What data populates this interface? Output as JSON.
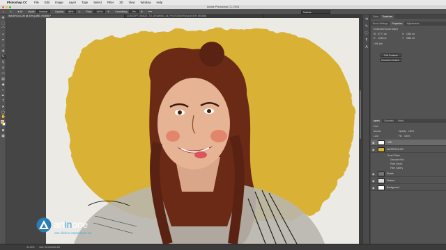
{
  "menubar": {
    "app": "Photoshop CC",
    "items": [
      "File",
      "Edit",
      "Image",
      "Layer",
      "Type",
      "Select",
      "Filter",
      "3D",
      "View",
      "Window",
      "Help"
    ]
  },
  "window": {
    "title": "Adobe Photoshop CC 2018"
  },
  "options": {
    "mode_label": "Mode:",
    "mode_value": "Normal",
    "opacity_label": "Opacity:",
    "opacity_value": "88%",
    "flow_label": "Flow:",
    "flow_value": "100%",
    "smoothing_label": "Smoothing:",
    "smoothing_value": "0%",
    "workspace": "Ilustrate"
  },
  "tabs": [
    {
      "label": "WATERCOLOR @ 33% (LINE, RGB/8) *"
    },
    {
      "label": "CONCEPT_IMAGE_TO_DRAWING_IN_PHOTOSHOP.psd @ 50% (RGB/8)"
    }
  ],
  "properties_panel": {
    "tabs": [
      "Color",
      "Swatches"
    ],
    "sub_tabs": [
      "Brush Settings",
      "Properties",
      "Adjustments"
    ],
    "smart_object_label": "Embedded Smart Object",
    "w_label": "W:",
    "w_value": "37.77 cm",
    "h_label": "H:",
    "h_value": "1068 cm",
    "x_label": "X:",
    "x_value": "-6.86 cm",
    "y_label": "Y:",
    "y_value": "3685 cm",
    "link_label": "LINE.psb",
    "edit_button": "Edit Contents",
    "convert_button": "Convert to Linked..."
  },
  "layers_panel": {
    "tabs": [
      "Layers",
      "Channels",
      "Paths"
    ],
    "kind_label": "Kind",
    "blend_mode": "Normal",
    "opacity_label": "Opacity:",
    "opacity_value": "100%",
    "lock_label": "Lock:",
    "fill_label": "Fill:",
    "fill_value": "100%",
    "layers": [
      {
        "name": "LINE",
        "selected": true
      },
      {
        "name": "WATERCOLOR",
        "selected": false
      },
      {
        "name": "Smart Filters",
        "selected": false,
        "sub": true
      },
      {
        "name": "Gaussian Blur",
        "selected": false,
        "sub": true
      },
      {
        "name": "Paint Daubs",
        "selected": false,
        "sub": true
      },
      {
        "name": "Filter Gallery",
        "selected": false,
        "sub": true
      },
      {
        "name": "Shade",
        "selected": false
      },
      {
        "name": "Texture",
        "selected": false
      },
      {
        "name": "Background",
        "selected": false
      }
    ]
  },
  "status": {
    "zoom": "33.33%",
    "doc": "Doc: 45.2M/343.9M"
  },
  "logo": {
    "art": "art",
    "in": "in",
    "one": "one",
    "tagline": "one click to experience art"
  },
  "colors": {
    "foreground": "#e8a32a",
    "background": "#ffffff",
    "accent": "#3aa9de",
    "watercolor": "#d9b234"
  }
}
